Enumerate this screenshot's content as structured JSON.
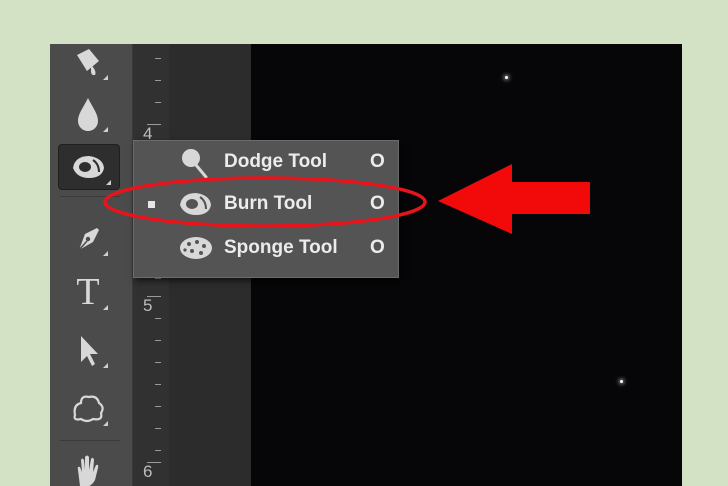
{
  "toolbar": {
    "tools": [
      {
        "icon": "paint-bucket-icon"
      },
      {
        "icon": "blur-drop-icon"
      },
      {
        "icon": "burn-tool-icon",
        "active": true
      },
      {
        "icon": "pen-icon"
      },
      {
        "icon": "type-icon",
        "glyph": "T"
      },
      {
        "icon": "path-selection-arrow-icon"
      },
      {
        "icon": "custom-shape-icon"
      },
      {
        "icon": "hand-icon"
      }
    ]
  },
  "ruler": {
    "numbers": [
      "4",
      "5",
      "6"
    ]
  },
  "tool_menu": {
    "items": [
      {
        "label": "Dodge Tool",
        "shortcut": "O",
        "icon": "dodge-tool-icon",
        "selected": false
      },
      {
        "label": "Burn Tool",
        "shortcut": "O",
        "icon": "burn-tool-icon",
        "selected": true
      },
      {
        "label": "Sponge Tool",
        "shortcut": "O",
        "icon": "sponge-tool-icon",
        "selected": false
      }
    ]
  },
  "annotation": {
    "highlight_color": "#e8141c",
    "arrow_color": "#f20a0a"
  },
  "colors": {
    "frame_background": "#d3e1c5",
    "canvas": "#060608",
    "toolbar": "#4b4b4b",
    "menu": "#545454"
  }
}
